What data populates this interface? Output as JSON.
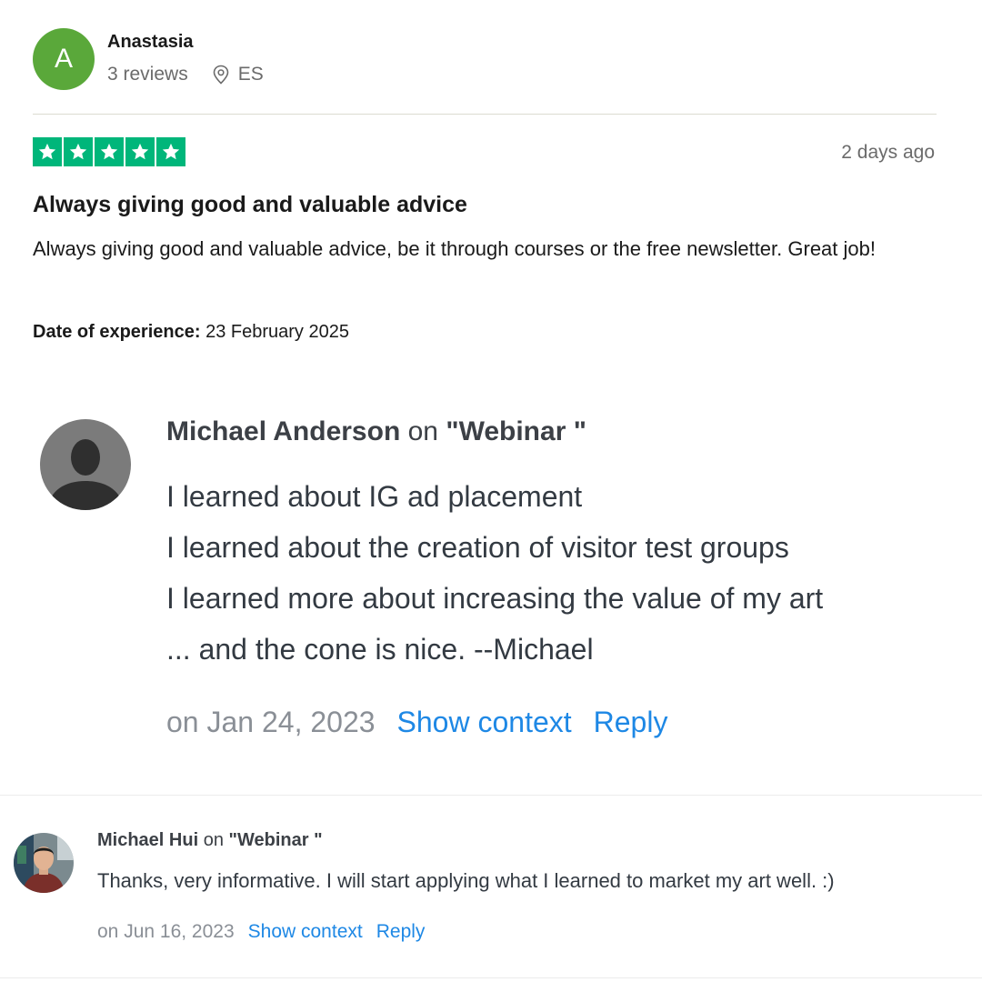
{
  "review": {
    "reviewer": {
      "initial": "A",
      "name": "Anastasia",
      "review_count": "3 reviews",
      "country": "ES",
      "avatar_color": "#5aa83a"
    },
    "rating": {
      "stars": 5,
      "max": 5,
      "color": "#00b67a"
    },
    "date": "2 days ago",
    "title": "Always giving good and valuable advice",
    "body": "Always giving good and valuable advice, be it through courses or the free newsletter. Great job!",
    "experience_label": "Date of experience:",
    "experience_date": "23 February 2025"
  },
  "comments": [
    {
      "author": "Michael Anderson",
      "on_word": "on",
      "topic": "\"Webinar \"",
      "lines": [
        "I learned about IG ad placement",
        "I learned about the creation of visitor test groups",
        "I learned more about increasing the value of my art",
        "... and the cone is nice. --Michael"
      ],
      "date": "on Jan 24, 2023",
      "show_context": "Show context",
      "reply": "Reply",
      "avatar": "silhouette-icon"
    },
    {
      "author": "Michael Hui",
      "on_word": "on",
      "topic": "\"Webinar \"",
      "text": "Thanks, very informative. I will start applying what I learned to market my art well. :)",
      "date": "on Jun 16, 2023",
      "show_context": "Show context",
      "reply": "Reply",
      "avatar": "photo-avatar"
    }
  ],
  "colors": {
    "link": "#1e88e5",
    "muted": "#8a8f96"
  }
}
